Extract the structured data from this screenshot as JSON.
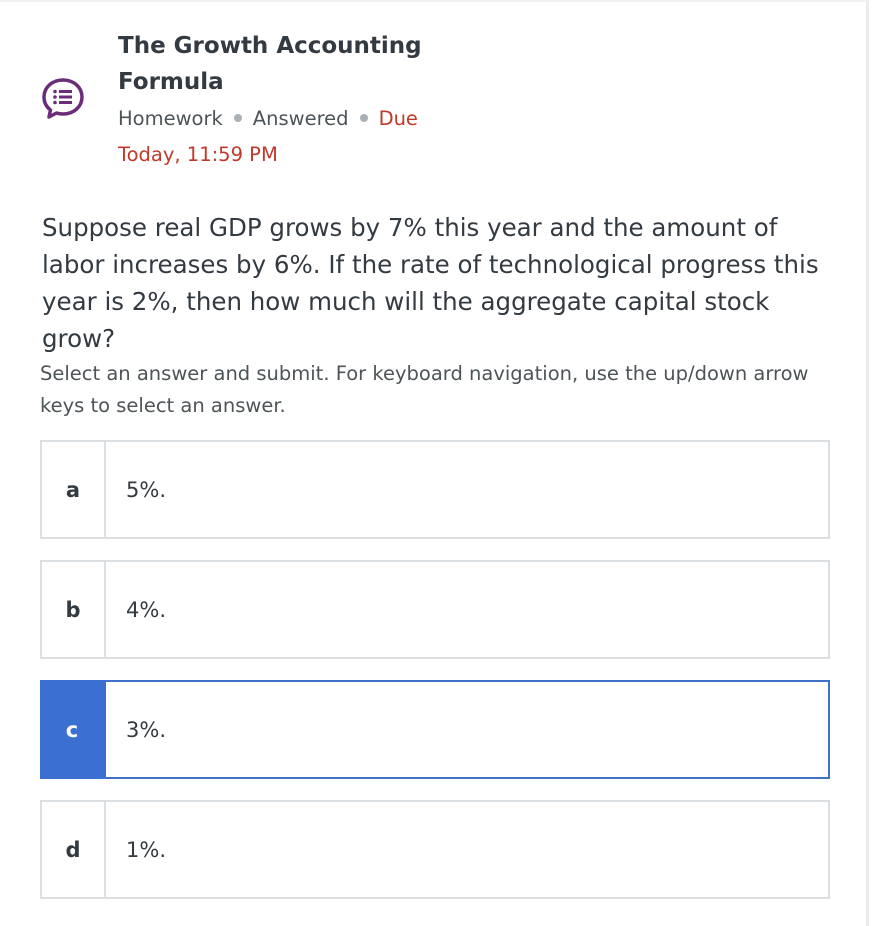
{
  "header": {
    "title": "The Growth Accounting Formula",
    "type": "Homework",
    "status": "Answered",
    "due_label": "Due",
    "due_time": "Today, 11:59 PM",
    "icon": "question-list-icon",
    "icon_color": "#6b2c7a"
  },
  "question": {
    "text": "Suppose real GDP grows by 7% this year and the amount of labor increases by 6%. If the rate of technological progress this year is 2%, then how much will the aggregate capital stock grow?"
  },
  "instructions": "Select an answer and submit. For keyboard navigation, use the up/down arrow keys to select an answer.",
  "options": [
    {
      "letter": "a",
      "text": "5%.",
      "selected": false
    },
    {
      "letter": "b",
      "text": "4%.",
      "selected": false
    },
    {
      "letter": "c",
      "text": "3%.",
      "selected": true
    },
    {
      "letter": "d",
      "text": "1%.",
      "selected": false
    }
  ],
  "colors": {
    "selected_accent": "#3b6fd0",
    "due_red": "#c0392b",
    "border": "#dcdfe2"
  }
}
